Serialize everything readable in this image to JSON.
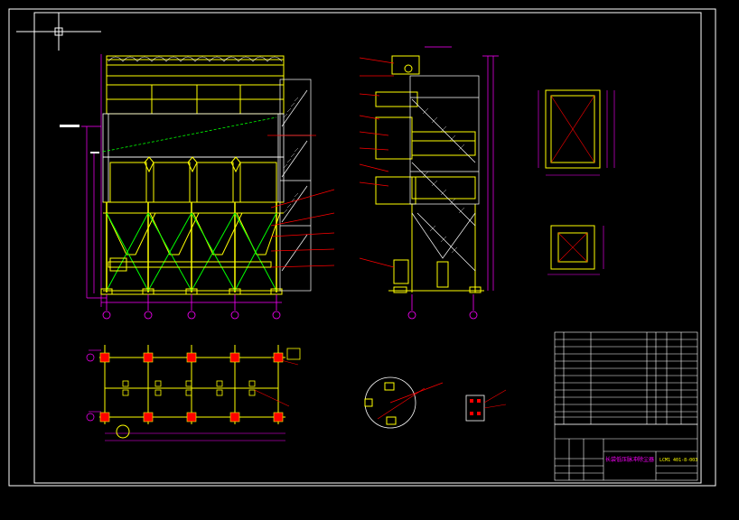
{
  "title_block": {
    "drawing_title": "长袋低压脉冲除尘器",
    "drawing_number": "LCM1 401-8-003"
  },
  "colors": {
    "background": "#000000",
    "frame": "#ffffff",
    "structure": "#ffff00",
    "bracing": "#00ff00",
    "dimensions": "#ff00ff",
    "leaders": "#ff0000",
    "grid_axis": "#ff00ff",
    "lines_white": "#ffffff",
    "cyan": "#00ffff"
  },
  "views": [
    {
      "id": "front-elevation"
    },
    {
      "id": "side-elevation"
    },
    {
      "id": "inlet-detail"
    },
    {
      "id": "outlet-detail"
    },
    {
      "id": "foundation-plan"
    },
    {
      "id": "ash-hopper-detail"
    },
    {
      "id": "anchor-detail"
    },
    {
      "id": "parts-list"
    }
  ]
}
